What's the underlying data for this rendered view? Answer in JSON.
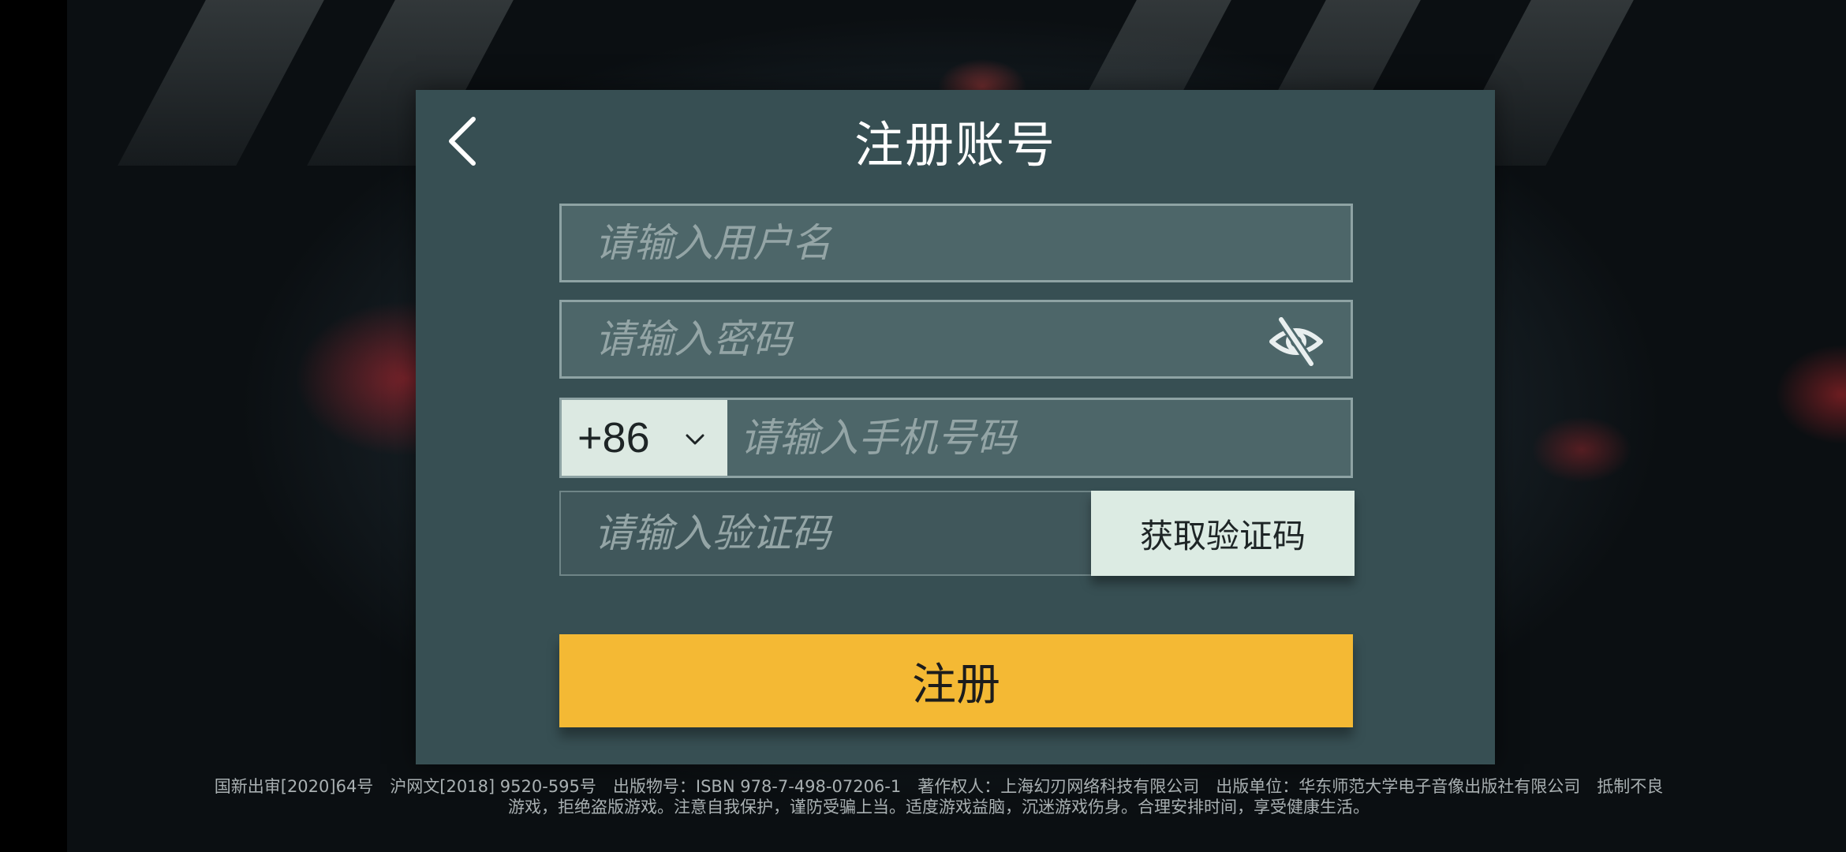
{
  "header": {
    "title": "注册账号",
    "back_icon": "chevron-left-icon"
  },
  "form": {
    "username_placeholder": "请输入用户名",
    "password_placeholder": "请输入密码",
    "password_visibility_icon": "eye-off-icon",
    "country_code": "+86",
    "country_code_icon": "chevron-down-icon",
    "phone_placeholder": "请输入手机号码",
    "code_placeholder": "请输入验证码",
    "get_code_label": "获取验证码",
    "register_label": "注册"
  },
  "footer": {
    "line1": "国新出审[2020]64号　沪网文[2018] 9520-595号　出版物号：ISBN 978-7-498-07206-1　著作权人：上海幻刃网络科技有限公司　出版单位：华东师范大学电子音像出版社有限公司　抵制不良",
    "line2": "游戏，拒绝盗版游戏。注意自我保护，谨防受骗上当。适度游戏益脑，沉迷游戏伤身。合理安排时间，享受健康生活。"
  },
  "colors": {
    "panel": "#374f53",
    "accent": "#f4b934",
    "light_button": "#dcebe3",
    "field_border": "#8ea3a4"
  }
}
